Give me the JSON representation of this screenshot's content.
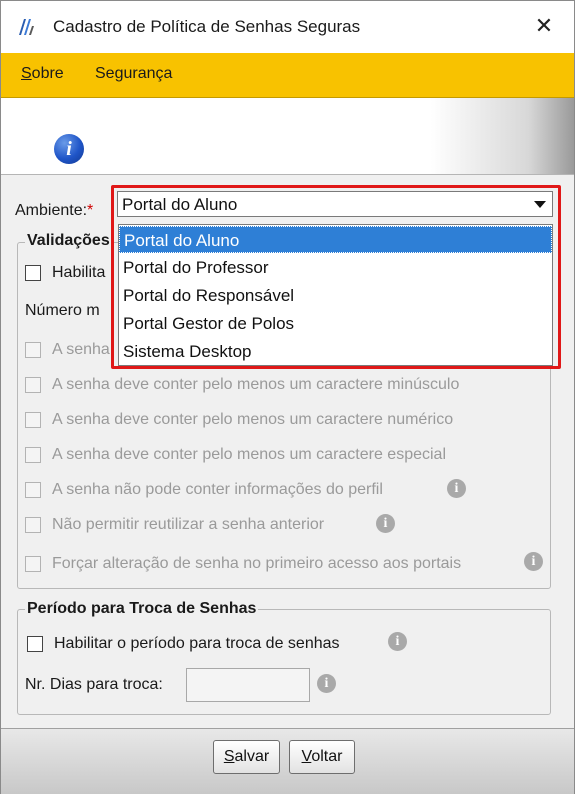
{
  "window": {
    "title": "Cadastro de Política de Senhas Seguras",
    "close_symbol": "✕",
    "app_icon": "app-logo-icon"
  },
  "menu": {
    "items": [
      {
        "first": "S",
        "rest": "obre"
      },
      {
        "first": "",
        "rest": "Segurança"
      }
    ]
  },
  "banner": {
    "icon": "info-icon",
    "glyph": "i"
  },
  "ambiente": {
    "label": "Ambiente:",
    "required_mark": "*",
    "selected": "Portal do Aluno",
    "options": [
      "Portal do Aluno",
      "Portal do Professor",
      "Portal do Responsável",
      "Portal Gestor de Polos",
      "Sistema Desktop"
    ],
    "selected_index": 0,
    "dropdown_open": true
  },
  "validacoes": {
    "legend": "Validações",
    "habilitar_label": "Habilita",
    "numero_label": "Número m",
    "rules": [
      {
        "label": "A senha",
        "info": false
      },
      {
        "label": "A senha deve conter pelo menos um caractere minúsculo",
        "info": false
      },
      {
        "label": "A senha deve conter pelo menos um caractere numérico",
        "info": false
      },
      {
        "label": "A senha deve conter pelo menos um caractere especial",
        "info": false
      },
      {
        "label": "A senha não pode conter informações do perfil",
        "info": true
      },
      {
        "label": "Não permitir reutilizar a senha anterior",
        "info": true
      },
      {
        "label": "Forçar alteração de senha no primeiro acesso aos portais",
        "info": true
      }
    ]
  },
  "periodo": {
    "legend": "Período para Troca de Senhas",
    "habilitar_label": "Habilitar o período para troca de senhas",
    "dias_label": "Nr. Dias para troca:",
    "dias_value": ""
  },
  "footer": {
    "salvar": {
      "first": "S",
      "rest": "alvar"
    },
    "voltar": {
      "first": "V",
      "rest": "oltar"
    }
  },
  "colors": {
    "menubar": "#f8c200",
    "selection": "#2e7fd6",
    "highlight_border": "#e01818"
  }
}
